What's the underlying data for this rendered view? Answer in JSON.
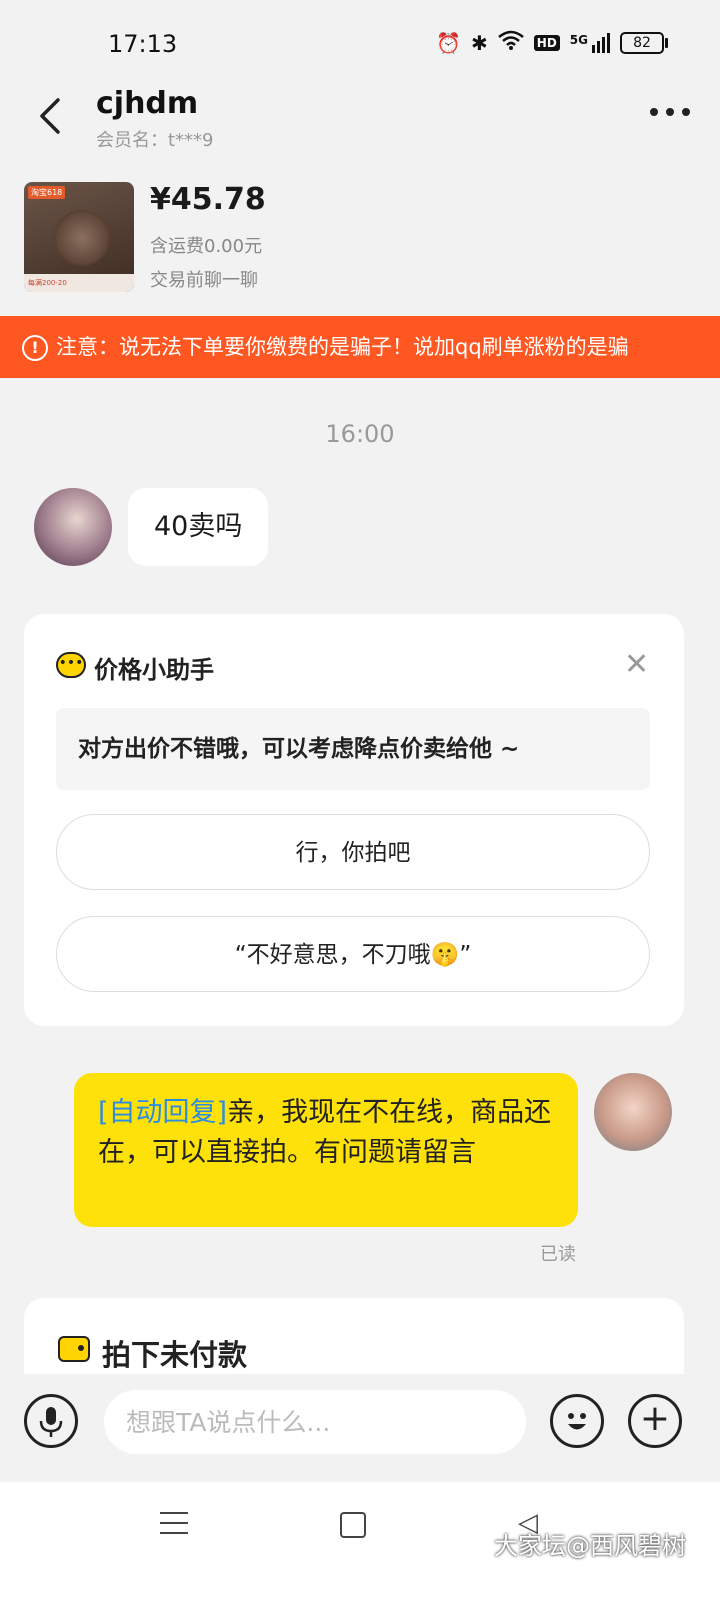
{
  "status_bar": {
    "time": "17:13",
    "network": "5G",
    "hd": "HD",
    "battery": "82"
  },
  "header": {
    "title": "cjhdm",
    "member_label": "会员名：t***9"
  },
  "product": {
    "price": "¥45.78",
    "shipping": "含运费0.00元",
    "chat_label": "交易前聊一聊",
    "thumb_tag": "淘宝618",
    "thumb_bottom": "每满200-20"
  },
  "warning": {
    "text": "注意：说无法下单要你缴费的是骗子！说加qq刷单涨粉的是骗"
  },
  "chat": {
    "time": "16:00",
    "buyer_message": "40卖吗",
    "seller_auto_tag": "[自动回复]",
    "seller_message": "亲，我现在不在线，商品还在，可以直接拍。有问题请留言",
    "read_status": "已读"
  },
  "assistant": {
    "title": "价格小助手",
    "tip": "对方出价不错哦，可以考虑降点价卖给他 ~",
    "reply_1": "行，你拍吧",
    "reply_2": "“不好意思，不刀哦🤫”"
  },
  "unpaid": {
    "title": "拍下未付款"
  },
  "input": {
    "placeholder": "想跟TA说点什么..."
  },
  "watermark": "大家坛@西风碧树",
  "colors": {
    "warning": "#ff5722",
    "bubble_self": "#ffe10a",
    "auto_reply_tag": "#2b8de0",
    "accent_yellow": "#ffd400"
  }
}
